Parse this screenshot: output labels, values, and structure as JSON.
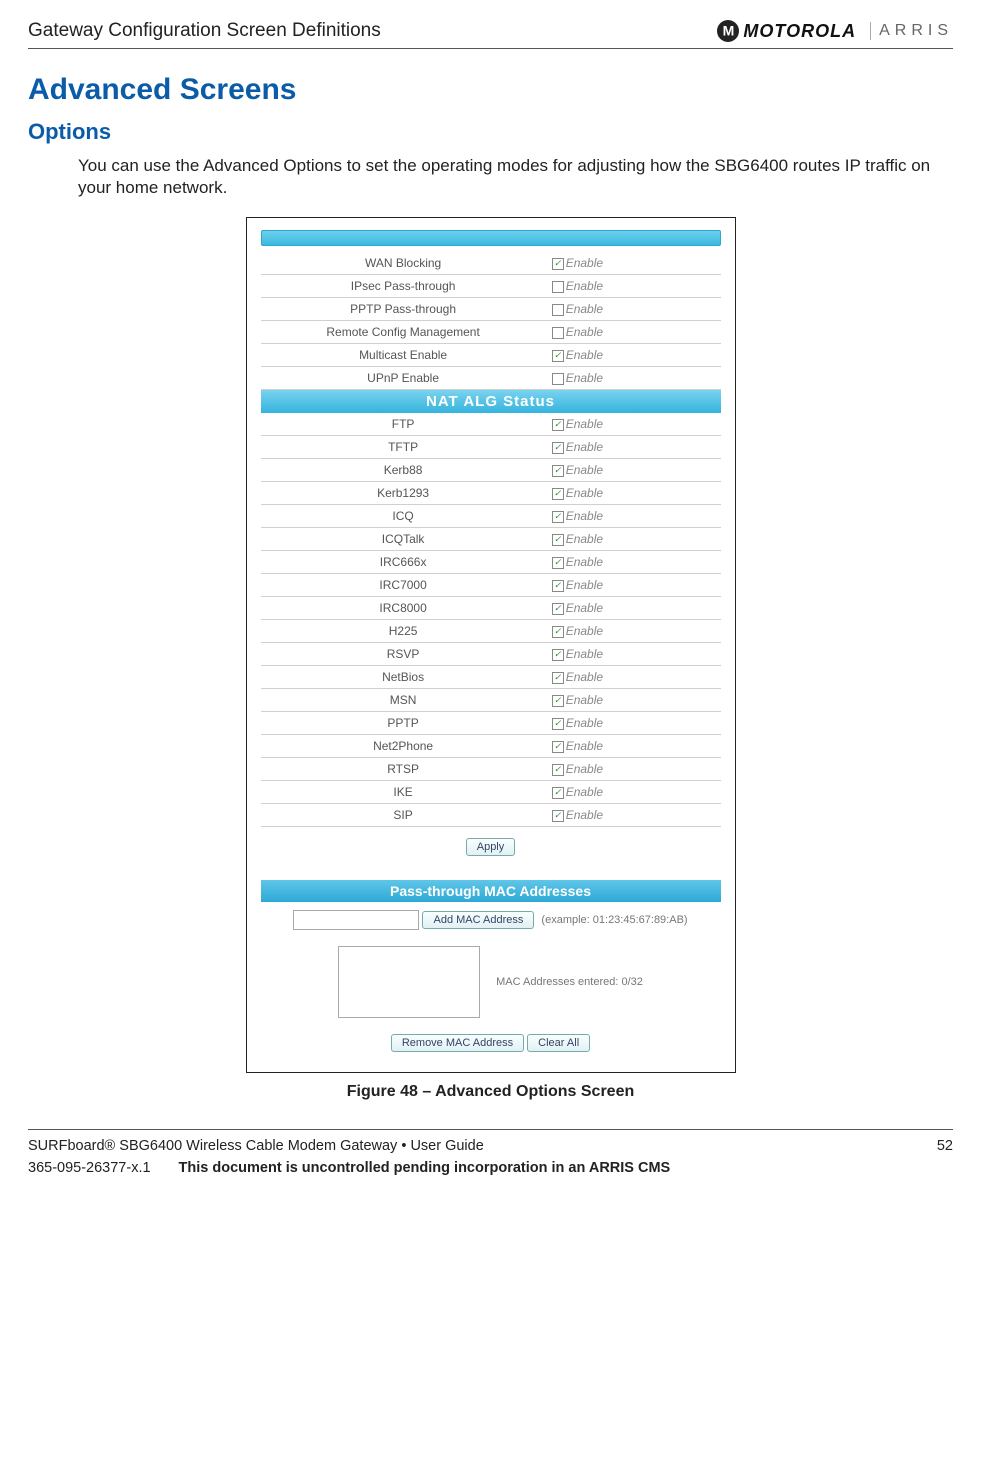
{
  "header": {
    "title": "Gateway Configuration Screen Definitions",
    "logo_motorola": "MOTOROLA",
    "logo_arris": "ARRIS"
  },
  "section_title": "Advanced Screens",
  "subsection_title": "Options",
  "body_text": "You can use the Advanced Options to set the operating modes for adjusting how the SBG6400 routes IP traffic on your home network.",
  "figure": {
    "caption": "Figure 48 – Advanced Options Screen",
    "enable_label": "Enable",
    "top_options": [
      {
        "label": "WAN Blocking",
        "checked": true
      },
      {
        "label": "IPsec Pass-through",
        "checked": false
      },
      {
        "label": "PPTP Pass-through",
        "checked": false
      },
      {
        "label": "Remote Config Management",
        "checked": false
      },
      {
        "label": "Multicast Enable",
        "checked": true
      },
      {
        "label": "UPnP Enable",
        "checked": false
      }
    ],
    "nat_header": "NAT ALG Status",
    "nat_options": [
      {
        "label": "FTP",
        "checked": true
      },
      {
        "label": "TFTP",
        "checked": true
      },
      {
        "label": "Kerb88",
        "checked": true
      },
      {
        "label": "Kerb1293",
        "checked": true
      },
      {
        "label": "ICQ",
        "checked": true
      },
      {
        "label": "ICQTalk",
        "checked": true
      },
      {
        "label": "IRC666x",
        "checked": true
      },
      {
        "label": "IRC7000",
        "checked": true
      },
      {
        "label": "IRC8000",
        "checked": true
      },
      {
        "label": "H225",
        "checked": true
      },
      {
        "label": "RSVP",
        "checked": true
      },
      {
        "label": "NetBios",
        "checked": true
      },
      {
        "label": "MSN",
        "checked": true
      },
      {
        "label": "PPTP",
        "checked": true
      },
      {
        "label": "Net2Phone",
        "checked": true
      },
      {
        "label": "RTSP",
        "checked": true
      },
      {
        "label": "IKE",
        "checked": true
      },
      {
        "label": "SIP",
        "checked": true
      }
    ],
    "apply_button": "Apply",
    "pass_header": "Pass-through MAC Addresses",
    "add_mac_button": "Add MAC Address",
    "mac_example": "(example: 01:23:45:67:89:AB)",
    "mac_count": "MAC Addresses entered: 0/32",
    "remove_mac_button": "Remove MAC Address",
    "clear_all_button": "Clear All"
  },
  "footer": {
    "product": "SURFboard® SBG6400 Wireless Cable Modem Gateway • User Guide",
    "page_number": "52",
    "doc_number": "365-095-26377-x.1",
    "notice": "This document is uncontrolled pending incorporation in an ARRIS CMS"
  }
}
